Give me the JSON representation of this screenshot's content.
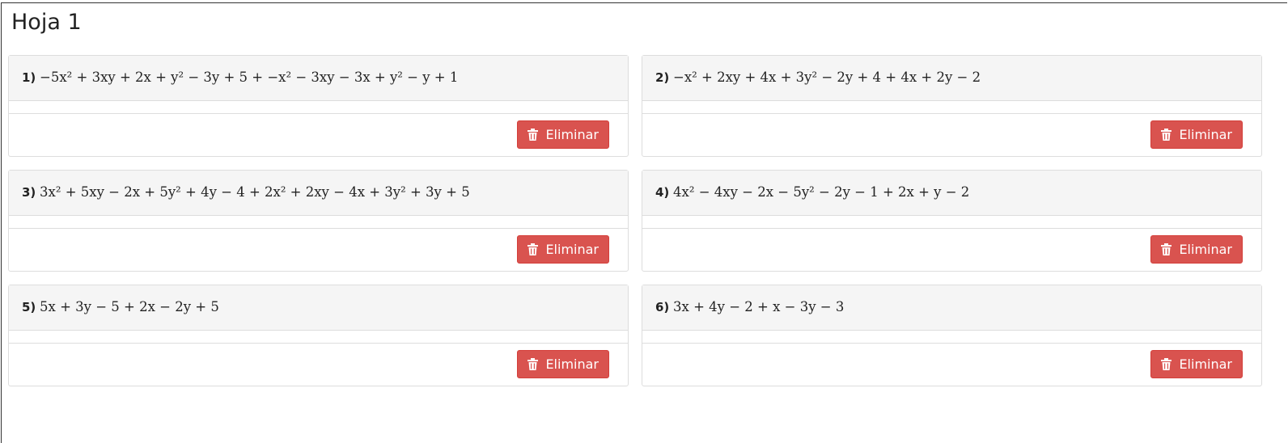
{
  "sheet": {
    "title": "Hoja 1"
  },
  "cards": [
    {
      "number": "1)",
      "expression": "−5x² + 3xy + 2x + y² − 3y + 5 + −x² − 3xy − 3x + y² − y + 1",
      "delete_label": "Eliminar"
    },
    {
      "number": "2)",
      "expression": "−x² + 2xy + 4x + 3y² − 2y + 4 + 4x + 2y − 2",
      "delete_label": "Eliminar"
    },
    {
      "number": "3)",
      "expression": "3x² + 5xy − 2x + 5y² + 4y − 4 + 2x² + 2xy − 4x + 3y² + 3y + 5",
      "delete_label": "Eliminar"
    },
    {
      "number": "4)",
      "expression": "4x² − 4xy − 2x − 5y² − 2y − 1 + 2x + y − 2",
      "delete_label": "Eliminar"
    },
    {
      "number": "5)",
      "expression": "5x + 3y − 5 + 2x − 2y + 5",
      "delete_label": "Eliminar"
    },
    {
      "number": "6)",
      "expression": "3x + 4y − 2 + x − 3y − 3",
      "delete_label": "Eliminar"
    }
  ],
  "colors": {
    "danger": "#d9534f",
    "panel_header": "#f5f5f5",
    "border": "#dddddd"
  },
  "icons": {
    "delete": "trash-icon"
  }
}
